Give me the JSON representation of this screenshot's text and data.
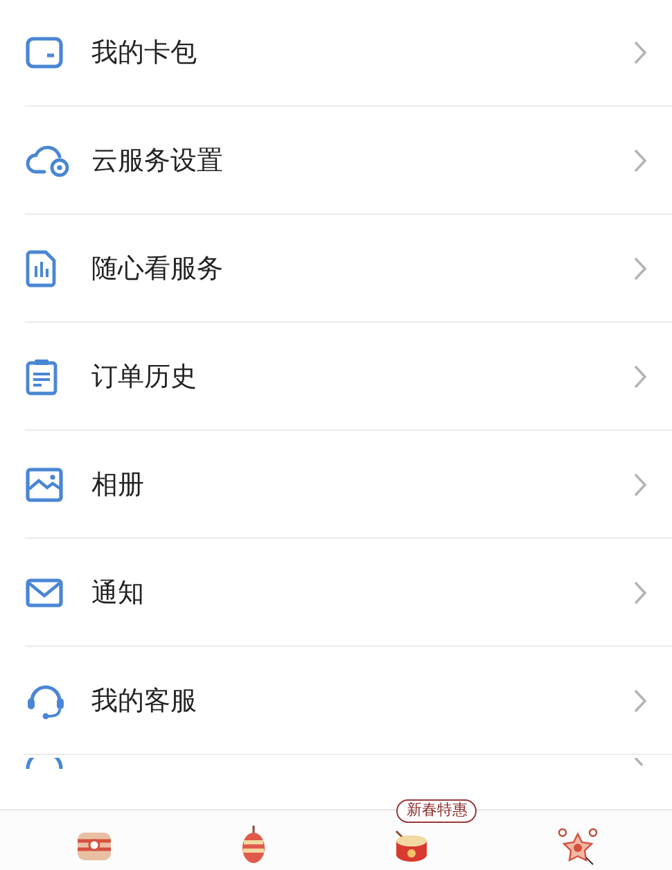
{
  "menu": [
    {
      "label": "我的卡包"
    },
    {
      "label": "云服务设置"
    },
    {
      "label": "随心看服务"
    },
    {
      "label": "订单历史"
    },
    {
      "label": "相册"
    },
    {
      "label": "通知"
    },
    {
      "label": "我的客服"
    }
  ],
  "tab_bar": {
    "badge": "新春特惠"
  }
}
